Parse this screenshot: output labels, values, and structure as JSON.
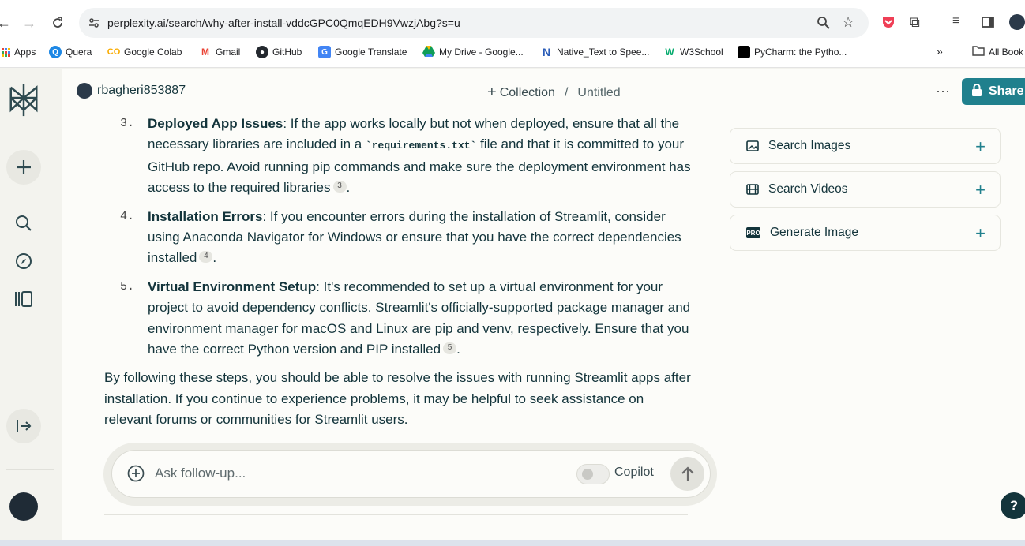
{
  "browser": {
    "url": "perplexity.ai/search/why-after-install-vddcGPC0QmqEDH9VwzjAbg?s=u",
    "bookmarks": [
      {
        "label": "Apps",
        "icon": "apps-grid-icon",
        "color": "#4285f4"
      },
      {
        "label": "Quera",
        "icon": "quera-icon",
        "color": "#1e88e5"
      },
      {
        "label": "Google Colab",
        "icon": "colab-icon",
        "color": "#f9ab00"
      },
      {
        "label": "Gmail",
        "icon": "gmail-icon",
        "color": "#ea4335"
      },
      {
        "label": "GitHub",
        "icon": "github-icon",
        "color": "#24292f"
      },
      {
        "label": "Google Translate",
        "icon": "translate-icon",
        "color": "#4285f4"
      },
      {
        "label": "My Drive - Google...",
        "icon": "drive-icon",
        "color": "#0f9d58"
      },
      {
        "label": "Native_Text to Spee...",
        "icon": "native-icon",
        "color": "#2b5db8"
      },
      {
        "label": "W3School",
        "icon": "w3school-icon",
        "color": "#04aa6d"
      },
      {
        "label": "PyCharm: the Pytho...",
        "icon": "pycharm-icon",
        "color": "#000000"
      }
    ],
    "all_bookmarks": "All Book"
  },
  "header": {
    "username": "rbagheri853887",
    "collection": "Collection",
    "separator": "/",
    "title": "Untitled",
    "more": "···",
    "share": "Share"
  },
  "answer": {
    "items": [
      {
        "num": "3.",
        "title": "Deployed App Issues",
        "text_a": ": If the app works locally but not when deployed, ensure that all the necessary libraries are included in a ",
        "code": "`requirements.txt`",
        "text_b": " file and that it is committed to your GitHub repo. Avoid running pip commands and make sure the deployment environment has access to the required libraries",
        "cite": "3",
        "end": "."
      },
      {
        "num": "4.",
        "title": "Installation Errors",
        "text_a": ": If you encounter errors during the installation of Streamlit, consider using Anaconda Navigator for Windows or ensure that you have the correct dependencies installed",
        "cite": "4",
        "end": "."
      },
      {
        "num": "5.",
        "title": "Virtual Environment Setup",
        "text_a": ": It's recommended to set up a virtual environment for your project to avoid dependency conflicts. Streamlit's officially-supported package manager and environment manager for macOS and Linux are pip and venv, respectively. Ensure that you have the correct Python version and PIP installed",
        "cite": "5",
        "end": "."
      }
    ],
    "conclusion": "By following these steps, you should be able to resolve the issues with running Streamlit apps after installation. If you continue to experience problems, it may be helpful to seek assistance on relevant forums or communities for Streamlit users."
  },
  "side_tools": [
    {
      "label": "Search Images",
      "icon": "image-icon"
    },
    {
      "label": "Search Videos",
      "icon": "film-icon"
    },
    {
      "label": "Generate Image",
      "icon": "pro-badge-icon",
      "badge": "PRO"
    }
  ],
  "ask": {
    "placeholder": "Ask follow-up...",
    "copilot_label": "Copilot",
    "copilot_on": false
  },
  "help": "?",
  "colors": {
    "accent": "#20808d",
    "dark": "#13343b"
  }
}
